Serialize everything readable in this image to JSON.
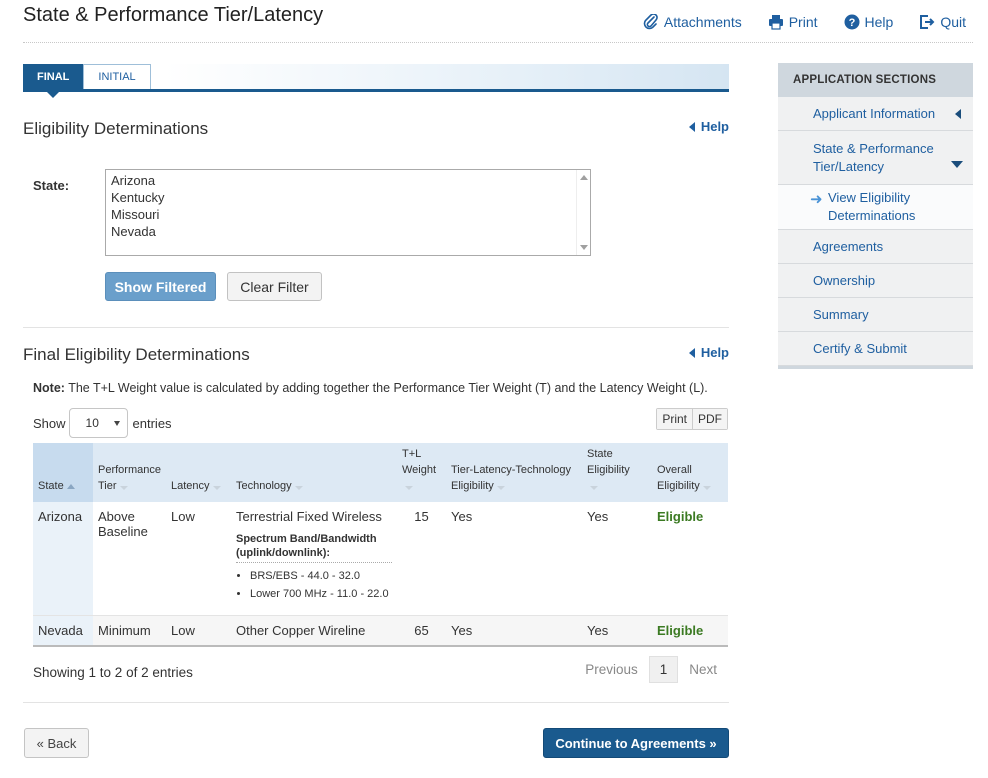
{
  "page": {
    "title": "State & Performance Tier/Latency"
  },
  "top_links": [
    {
      "label": "Attachments",
      "icon": "paperclip-icon"
    },
    {
      "label": "Print",
      "icon": "printer-icon"
    },
    {
      "label": "Help",
      "icon": "help-circle-icon"
    },
    {
      "label": "Quit",
      "icon": "exit-icon"
    }
  ],
  "tabs": {
    "final": "FINAL",
    "initial": "INITIAL"
  },
  "eligibility": {
    "heading": "Eligibility Determinations",
    "help_label": "Help",
    "state_label": "State:",
    "states": [
      "Arizona",
      "Kentucky",
      "Missouri",
      "Nevada"
    ],
    "show_filtered": "Show Filtered",
    "clear_filter": "Clear Filter"
  },
  "final": {
    "heading": "Final Eligibility Determinations",
    "help_label": "Help",
    "note_label": "Note:",
    "note_text": "The T+L Weight value is calculated by adding together the Performance Tier Weight (T) and the Latency Weight (L).",
    "show_label": "Show",
    "entries_value": "10",
    "entries_label": "entries",
    "print": "Print",
    "pdf": "PDF"
  },
  "table": {
    "headers": {
      "state": "State",
      "tier_1": "Performance",
      "tier_2": "Tier",
      "latency": "Latency",
      "technology": "Technology",
      "weight_1": "T+L",
      "weight_2": "Weight",
      "tlt_1": "Tier-Latency-Technology",
      "tlt_2": "Eligibility",
      "state_elig_1": "State",
      "state_elig_2": "Eligibility",
      "overall_1": "Overall",
      "overall_2": "Eligibility"
    },
    "rows": [
      {
        "state": "Arizona",
        "tier_1": "Above",
        "tier_2": "Baseline",
        "latency": "Low",
        "technology": "Terrestrial Fixed Wireless",
        "spectrum_header_1": "Spectrum Band/Bandwidth",
        "spectrum_header_2": "(uplink/downlink):",
        "spectrum": [
          "BRS/EBS - 44.0 - 32.0",
          "Lower 700 MHz - 11.0 - 22.0"
        ],
        "weight": "15",
        "tlt": "Yes",
        "state_elig": "Yes",
        "overall": "Eligible"
      },
      {
        "state": "Nevada",
        "tier_1": "Minimum",
        "latency": "Low",
        "technology": "Other Copper Wireline",
        "weight": "65",
        "tlt": "Yes",
        "state_elig": "Yes",
        "overall": "Eligible"
      }
    ],
    "showing": "Showing 1 to 2 of 2 entries",
    "pager": {
      "previous": "Previous",
      "current": "1",
      "next": "Next"
    }
  },
  "footer": {
    "back": "« Back",
    "continue": "Continue to Agreements »"
  },
  "sidebar": {
    "title": "APPLICATION SECTIONS",
    "items": [
      "Applicant Information",
      "State & Performance Tier/Latency",
      "View Eligibility Determinations",
      "Agreements",
      "Ownership",
      "Summary",
      "Certify & Submit"
    ]
  },
  "colors": {
    "primary": "#1a5a8e",
    "link": "#1f5fa0",
    "eligible": "#3b7a22"
  }
}
